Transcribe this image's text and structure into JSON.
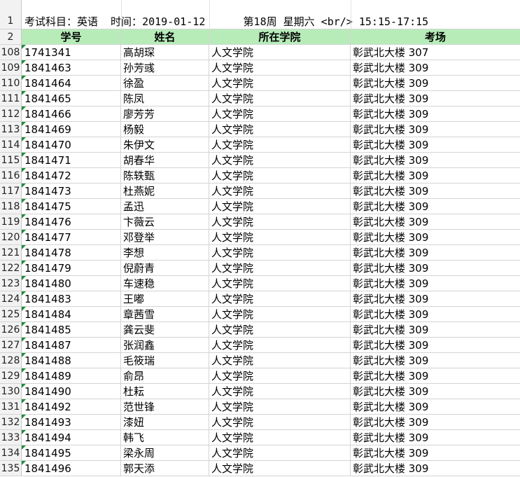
{
  "title_row": {
    "row_number": "1",
    "text": "考试科目：英语  时间：2019-01-12      第18周 星期六 <br/> 15:15-17:15"
  },
  "header_row": {
    "row_number": "2",
    "columns": [
      "学号",
      "姓名",
      "所在学院",
      "考场"
    ]
  },
  "rows": [
    {
      "num": "108",
      "id": "1741341",
      "name": "高胡琛",
      "college": "人文学院",
      "room": "彰武北大楼 307"
    },
    {
      "num": "109",
      "id": "1841463",
      "name": "孙芳彧",
      "college": "人文学院",
      "room": "彰武北大楼 309"
    },
    {
      "num": "110",
      "id": "1841464",
      "name": "徐盈",
      "college": "人文学院",
      "room": "彰武北大楼 309"
    },
    {
      "num": "111",
      "id": "1841465",
      "name": "陈凤",
      "college": "人文学院",
      "room": "彰武北大楼 309"
    },
    {
      "num": "112",
      "id": "1841466",
      "name": "廖芳芳",
      "college": "人文学院",
      "room": "彰武北大楼 309"
    },
    {
      "num": "113",
      "id": "1841469",
      "name": "杨毅",
      "college": "人文学院",
      "room": "彰武北大楼 309"
    },
    {
      "num": "114",
      "id": "1841470",
      "name": "朱伊文",
      "college": "人文学院",
      "room": "彰武北大楼 309"
    },
    {
      "num": "115",
      "id": "1841471",
      "name": "胡春华",
      "college": "人文学院",
      "room": "彰武北大楼 309"
    },
    {
      "num": "116",
      "id": "1841472",
      "name": "陈轶甄",
      "college": "人文学院",
      "room": "彰武北大楼 309"
    },
    {
      "num": "117",
      "id": "1841473",
      "name": "杜燕妮",
      "college": "人文学院",
      "room": "彰武北大楼 309"
    },
    {
      "num": "118",
      "id": "1841475",
      "name": "孟迅",
      "college": "人文学院",
      "room": "彰武北大楼 309"
    },
    {
      "num": "119",
      "id": "1841476",
      "name": "卞薇云",
      "college": "人文学院",
      "room": "彰武北大楼 309"
    },
    {
      "num": "120",
      "id": "1841477",
      "name": "邓登举",
      "college": "人文学院",
      "room": "彰武北大楼 309"
    },
    {
      "num": "121",
      "id": "1841478",
      "name": "李想",
      "college": "人文学院",
      "room": "彰武北大楼 309"
    },
    {
      "num": "122",
      "id": "1841479",
      "name": "倪蔚青",
      "college": "人文学院",
      "room": "彰武北大楼 309"
    },
    {
      "num": "123",
      "id": "1841480",
      "name": "车速稳",
      "college": "人文学院",
      "room": "彰武北大楼 309"
    },
    {
      "num": "124",
      "id": "1841483",
      "name": "王嘟",
      "college": "人文学院",
      "room": "彰武北大楼 309"
    },
    {
      "num": "125",
      "id": "1841484",
      "name": "章茜雪",
      "college": "人文学院",
      "room": "彰武北大楼 309"
    },
    {
      "num": "126",
      "id": "1841485",
      "name": "龚云斐",
      "college": "人文学院",
      "room": "彰武北大楼 309"
    },
    {
      "num": "127",
      "id": "1841487",
      "name": "张润鑫",
      "college": "人文学院",
      "room": "彰武北大楼 309"
    },
    {
      "num": "128",
      "id": "1841488",
      "name": "毛筱瑞",
      "college": "人文学院",
      "room": "彰武北大楼 309"
    },
    {
      "num": "129",
      "id": "1841489",
      "name": "俞昂",
      "college": "人文学院",
      "room": "彰武北大楼 309"
    },
    {
      "num": "130",
      "id": "1841490",
      "name": "杜耘",
      "college": "人文学院",
      "room": "彰武北大楼 309"
    },
    {
      "num": "131",
      "id": "1841492",
      "name": "范世锋",
      "college": "人文学院",
      "room": "彰武北大楼 309"
    },
    {
      "num": "132",
      "id": "1841493",
      "name": "漆妞",
      "college": "人文学院",
      "room": "彰武北大楼 309"
    },
    {
      "num": "133",
      "id": "1841494",
      "name": "韩飞",
      "college": "人文学院",
      "room": "彰武北大楼 309"
    },
    {
      "num": "134",
      "id": "1841495",
      "name": "梁永周",
      "college": "人文学院",
      "room": "彰武北大楼 309"
    },
    {
      "num": "135",
      "id": "1841496",
      "name": "郭天添",
      "college": "人文学院",
      "room": "彰武北大楼 309"
    }
  ],
  "colors": {
    "header_fill": "#b7ecb9",
    "row_header_fill": "#f2f2f2",
    "gridline": "#d4d4d4",
    "error_indicator": "#1e8c3a"
  }
}
